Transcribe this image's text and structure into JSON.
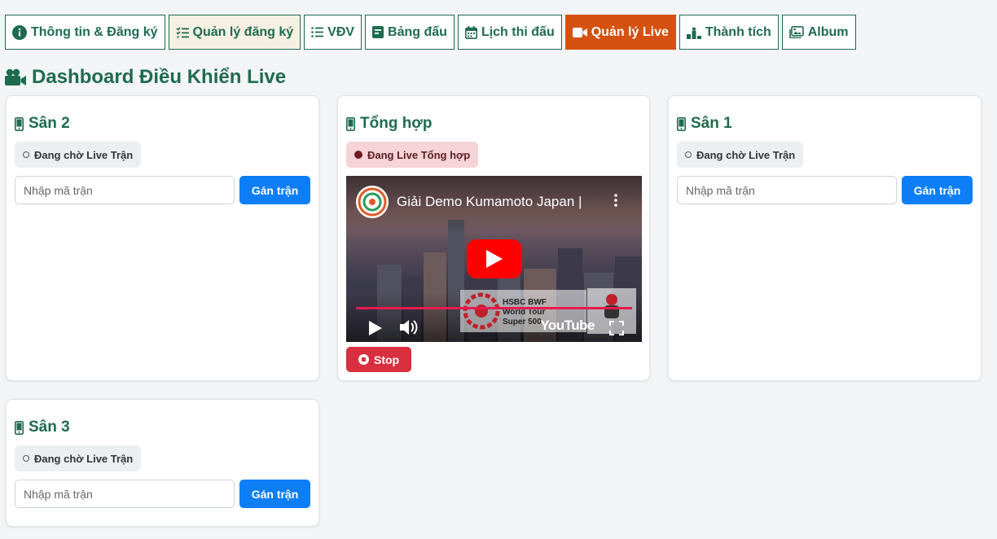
{
  "nav": {
    "tabs": [
      {
        "label": "Thông tin & Đăng ký",
        "icon": "info-circle-icon"
      },
      {
        "label": "Quản lý đăng ký",
        "icon": "checklist-icon"
      },
      {
        "label": "VĐV",
        "icon": "list-icon"
      },
      {
        "label": "Bảng đấu",
        "icon": "bracket-icon"
      },
      {
        "label": "Lịch thi đấu",
        "icon": "calendar-icon"
      },
      {
        "label": "Quản lý Live",
        "icon": "video-camera-icon"
      },
      {
        "label": "Thành tích",
        "icon": "podium-icon"
      },
      {
        "label": "Album",
        "icon": "images-icon"
      }
    ],
    "active_index": 5,
    "highlight_index": 1
  },
  "page": {
    "title": "Dashboard Điều Khiển Live",
    "title_icon": "video-camera-icon"
  },
  "colors": {
    "primary": "#1f6b4f",
    "active_tab": "#d4510f",
    "assign_button": "#0d7ef5",
    "stop_button": "#d8303f",
    "live_badge": "#f6d3d6"
  },
  "courts": [
    {
      "name": "Sân 2",
      "icon": "mobile-phone-icon",
      "status": "Đang chờ Live Trận",
      "placeholder": "Nhập mã trận",
      "button": "Gán trận"
    },
    {
      "name": "Tổng hợp",
      "icon": "mobile-phone-icon",
      "status": "Đang Live Tổng hợp",
      "video_title": "Giải Demo Kumamoto Japan |",
      "stop_label": "Stop"
    },
    {
      "name": "Sân 1",
      "icon": "mobile-phone-icon",
      "status": "Đang chờ Live Trận",
      "placeholder": "Nhập mã trận",
      "button": "Gán trận"
    },
    {
      "name": "Sân 3",
      "icon": "mobile-phone-icon",
      "status": "Đang chờ Live Trận",
      "placeholder": "Nhập mã trận",
      "button": "Gán trận"
    }
  ],
  "video": {
    "banner_text_1": "HSBC BWF",
    "banner_text_2": "World Tour",
    "banner_text_3": "Super 500",
    "platform": "YouTube"
  }
}
